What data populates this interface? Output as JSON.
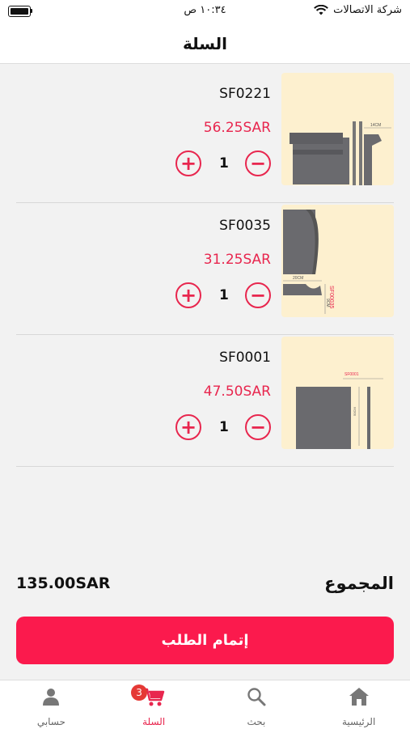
{
  "status": {
    "carrier": "شركة الاتصالات",
    "time": "١٠:٣٤ ص"
  },
  "header": {
    "title": "السلة"
  },
  "cart": {
    "items": [
      {
        "sku": "SF0221",
        "price": "56.25SAR",
        "qty": "1",
        "thumb_text": [
          "14CM"
        ]
      },
      {
        "sku": "SF0035",
        "price": "31.25SAR",
        "qty": "1",
        "thumb_text": [
          "SF00035",
          "20CM",
          "9CM"
        ]
      },
      {
        "sku": "SF0001",
        "price": "47.50SAR",
        "qty": "1",
        "thumb_text": [
          "SF0001",
          "50CM"
        ]
      }
    ]
  },
  "summary": {
    "label": "المجموع",
    "total": "135.00SAR"
  },
  "checkout": {
    "label": "إتمام الطلب"
  },
  "tabs": [
    {
      "label": "حسابي",
      "icon": "person-icon"
    },
    {
      "label": "السلة",
      "icon": "cart-icon",
      "badge": "3",
      "active": true
    },
    {
      "label": "بحث",
      "icon": "search-icon"
    },
    {
      "label": "الرئيسية",
      "icon": "home-icon"
    }
  ],
  "colors": {
    "accent": "#e8264e",
    "checkout": "#fb1a4d",
    "thumb_bg": "#fdf0cf",
    "badge": "#e53935"
  }
}
